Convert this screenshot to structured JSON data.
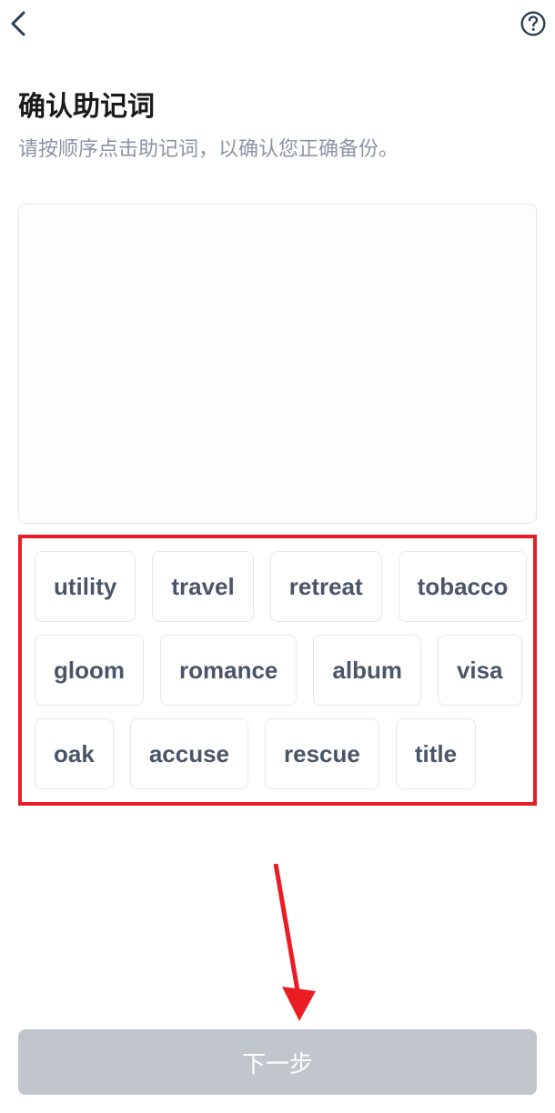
{
  "navbar": {
    "back_icon": "chevron-left",
    "help_icon": "question-circle"
  },
  "header": {
    "title": "确认助记词",
    "subtitle": "请按顺序点击助记词，以确认您正确备份。"
  },
  "words": {
    "row1": [
      "utility",
      "travel",
      "retreat",
      "tobacco"
    ],
    "row2": [
      "gloom",
      "romance",
      "album",
      "visa"
    ],
    "row3": [
      "oak",
      "accuse",
      "rescue",
      "title"
    ]
  },
  "footer": {
    "next_label": "下一步"
  },
  "annotation": {
    "highlight_color": "#ec1c24",
    "arrow_color": "#ec1c24"
  }
}
